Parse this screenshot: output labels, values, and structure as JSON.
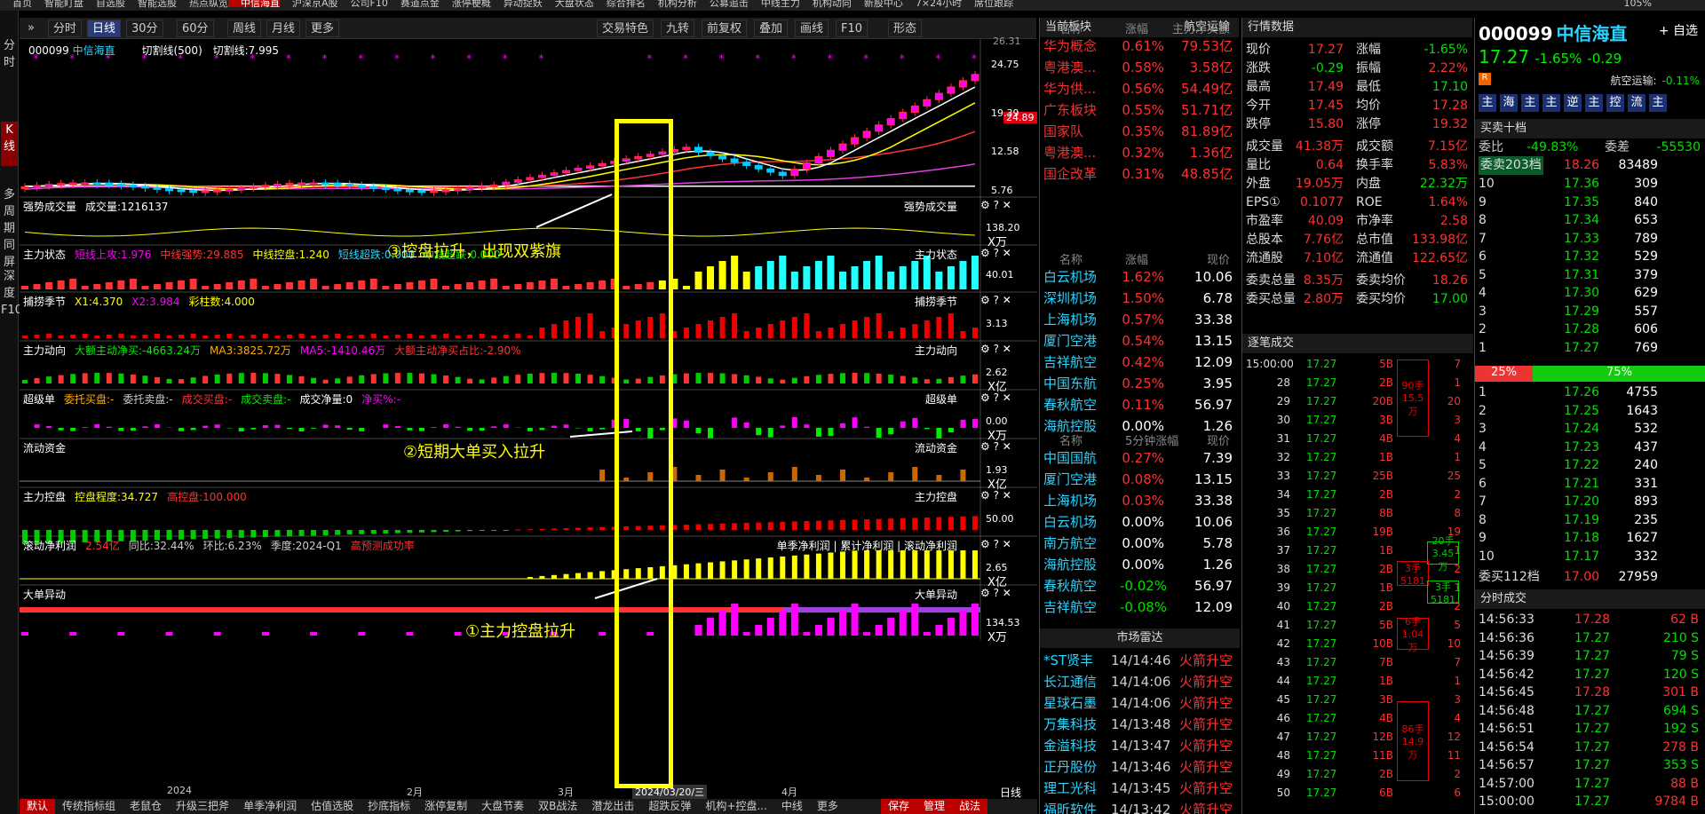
{
  "topnav": {
    "items": [
      "首页",
      "智能盯盘",
      "自选股",
      "智能选股",
      "热点纵览",
      "中信海直",
      "沪深京A股",
      "公司F10",
      "赛道点金",
      "涨停梗概",
      "异动捉妖",
      "大盘状态",
      "综合排名",
      "机构分析",
      "公募追击",
      "中线主力",
      "机构动向",
      "新股中心",
      "7×24小时",
      "席位跟踪"
    ],
    "active": "中信海直",
    "zoom": "105%"
  },
  "leftbar": {
    "items": [
      "分时",
      "K线",
      "多周期同屏",
      "深度F10"
    ]
  },
  "toolbar": {
    "periods": [
      "分时",
      "日线",
      "30分",
      "60分",
      "周线",
      "月线",
      "更多"
    ],
    "active": "日线",
    "right": [
      "交易特色",
      "九转",
      "前复权",
      "叠加",
      "画线",
      "F10",
      "形态"
    ]
  },
  "main": {
    "stock_code": "000099",
    "stock_name": "中信海直",
    "indicator": "切割线(500)",
    "cut_line": "切割线:7.995",
    "y_labels": [
      "24.75",
      "19.39",
      "12.58",
      "5.76"
    ],
    "price_flag": "24.89",
    "top_label": "26.31",
    "x_labels": [
      "2024",
      "2月",
      "3月",
      "2024/03/20/三",
      "4月"
    ],
    "x_label_right": "日线"
  },
  "panels": [
    {
      "title": "强势成交量",
      "items": [
        {
          "t": "成交量:1216137",
          "c": "#fff"
        }
      ],
      "right": "强势成交量",
      "val": "138.20",
      "unit": "X万"
    },
    {
      "title": "主力状态",
      "items": [
        {
          "t": "短线上攻:1.976",
          "c": "#f0f"
        },
        {
          "t": "中线强势:29.885",
          "c": "#f33"
        },
        {
          "t": "中线控盘:1.240",
          "c": "#ff0"
        },
        {
          "t": "短线超跌:0.000",
          "c": "#2ad4ff"
        },
        {
          "t": "中线超跌:0.000",
          "c": "#0e0"
        }
      ],
      "right": "主力状态",
      "val": "40.01",
      "unit": ""
    },
    {
      "title": "捕捞季节",
      "items": [
        {
          "t": "X1:4.370",
          "c": "#ff0"
        },
        {
          "t": "X2:3.984",
          "c": "#f0f"
        },
        {
          "t": "彩柱数:4.000",
          "c": "#ff0"
        }
      ],
      "right": "捕捞季节",
      "val": "3.13",
      "unit": ""
    },
    {
      "title": "主力动向",
      "items": [
        {
          "t": "大额主动净买:-4663.24万",
          "c": "#0e0"
        },
        {
          "t": "MA3:3825.72万",
          "c": "#fa0"
        },
        {
          "t": "MA5:-1410.46万",
          "c": "#f0f"
        },
        {
          "t": "大额主动净买占比:-2.90%",
          "c": "#f33"
        }
      ],
      "right": "主力动向",
      "val": "2.62",
      "unit": "X亿"
    },
    {
      "title": "超级单",
      "items": [
        {
          "t": "委托买盘:-",
          "c": "#fa0"
        },
        {
          "t": "委托卖盘:-",
          "c": "#ccc"
        },
        {
          "t": "成交买盘:-",
          "c": "#f33"
        },
        {
          "t": "成交卖盘:-",
          "c": "#0e0"
        },
        {
          "t": "成交净量:0",
          "c": "#fff"
        },
        {
          "t": "净买%:-",
          "c": "#f0f"
        }
      ],
      "right": "超级单",
      "val": "0.00",
      "unit": "X万"
    },
    {
      "title": "流动资金",
      "items": [],
      "right": "流动资金",
      "val": "1.93",
      "unit": "X亿"
    },
    {
      "title": "主力控盘",
      "items": [
        {
          "t": "控盘程度:34.727",
          "c": "#ff0"
        },
        {
          "t": "高控盘:100.000",
          "c": "#f33"
        }
      ],
      "right": "主力控盘",
      "val": "50.00",
      "unit": ""
    },
    {
      "title": "滚动净利润",
      "items": [
        {
          "t": "2.54亿",
          "c": "#f33"
        },
        {
          "t": "同比:32.44%",
          "c": "#ccc"
        },
        {
          "t": "环比:6.23%",
          "c": "#ccc"
        },
        {
          "t": "季度:2024-Q1",
          "c": "#ccc"
        },
        {
          "t": "高预测成功率",
          "c": "#f33"
        }
      ],
      "right": "单季净利润 | 累计净利润 | 滚动净利润",
      "val": "2.65",
      "unit": "X亿"
    },
    {
      "title": "大单异动",
      "items": [],
      "right": "大单异动",
      "val": "134.53",
      "unit": "X万"
    }
  ],
  "annotations": [
    "③控盘拉升，出现双紫旗",
    "②短期大单买入拉升",
    "①主力控盘拉升"
  ],
  "bottom_tabs": [
    "默认",
    "传统指标组",
    "老鼠仓",
    "升级三把斧",
    "单季净利润",
    "估值选股",
    "抄底指标",
    "涨停复制",
    "大盘节奏",
    "双B战法",
    "潜龙出击",
    "超跌反弹",
    "机构+控盘...",
    "中线",
    "更多",
    "保存",
    "管理",
    "战法"
  ],
  "sector": {
    "header": "当前板块",
    "header_right": "航空运输",
    "g1_cols": [
      "名称",
      "涨幅",
      "主力净买额"
    ],
    "g1": [
      [
        "华为概念",
        "0.61%",
        "79.53亿"
      ],
      [
        "粤港澳...",
        "0.58%",
        "3.58亿"
      ],
      [
        "华为供...",
        "0.56%",
        "54.49亿"
      ],
      [
        "广东板块",
        "0.55%",
        "51.71亿"
      ],
      [
        "国家队",
        "0.35%",
        "81.89亿"
      ],
      [
        "粤港澳...",
        "0.32%",
        "1.36亿"
      ],
      [
        "国企改革",
        "0.31%",
        "48.85亿"
      ]
    ],
    "g2_cols": [
      "名称",
      "涨幅",
      "现价"
    ],
    "g2": [
      [
        "白云机场",
        "1.62%",
        "10.06"
      ],
      [
        "深圳机场",
        "1.50%",
        "6.78"
      ],
      [
        "上海机场",
        "0.57%",
        "33.38"
      ],
      [
        "厦门空港",
        "0.54%",
        "13.15"
      ],
      [
        "吉祥航空",
        "0.42%",
        "12.09"
      ],
      [
        "中国东航",
        "0.25%",
        "3.95"
      ],
      [
        "春秋航空",
        "0.11%",
        "56.97"
      ],
      [
        "海航控股",
        "0.00%",
        "1.26"
      ]
    ],
    "g3_cols": [
      "名称",
      "5分钟涨幅",
      "现价"
    ],
    "g3": [
      [
        "中国国航",
        "0.27%",
        "7.39"
      ],
      [
        "厦门空港",
        "0.08%",
        "13.15"
      ],
      [
        "上海机场",
        "0.03%",
        "33.38"
      ],
      [
        "白云机场",
        "0.00%",
        "10.06"
      ],
      [
        "南方航空",
        "0.00%",
        "5.78"
      ],
      [
        "海航控股",
        "0.00%",
        "1.26"
      ],
      [
        "春秋航空",
        "-0.02%",
        "56.97"
      ],
      [
        "吉祥航空",
        "-0.08%",
        "12.09"
      ]
    ],
    "radar_title": "市场雷达",
    "radar": [
      [
        "*ST贤丰",
        "14/14:46",
        "火箭升空"
      ],
      [
        "长江通信",
        "14/14:06",
        "火箭升空"
      ],
      [
        "星球石墨",
        "14/14:06",
        "火箭升空"
      ],
      [
        "万集科技",
        "14/13:48",
        "火箭升空"
      ],
      [
        "金溢科技",
        "14/13:47",
        "火箭升空"
      ],
      [
        "正丹股份",
        "14/13:46",
        "火箭升空"
      ],
      [
        "理工光科",
        "14/13:45",
        "火箭升空"
      ],
      [
        "福昕软件",
        "14/13:42",
        "火箭升空"
      ]
    ]
  },
  "quote": {
    "title": "行情数据",
    "rows": [
      [
        "现价",
        "17.27",
        "涨幅",
        "-1.65%"
      ],
      [
        "涨跌",
        "-0.29",
        "振幅",
        "2.22%"
      ],
      [
        "最高",
        "17.49",
        "最低",
        "17.10"
      ],
      [
        "今开",
        "17.45",
        "均价",
        "17.28"
      ],
      [
        "跌停",
        "15.80",
        "涨停",
        "19.32"
      ],
      [
        "成交量",
        "41.38万",
        "成交额",
        "7.15亿"
      ],
      [
        "量比",
        "0.64",
        "换手率",
        "5.83%"
      ],
      [
        "外盘",
        "19.05万",
        "内盘",
        "22.32万"
      ],
      [
        "EPS①",
        "0.1077",
        "ROE",
        "1.64%"
      ],
      [
        "市盈率",
        "40.09",
        "市净率",
        "2.58"
      ],
      [
        "总股本",
        "7.76亿",
        "总市值",
        "133.98亿"
      ],
      [
        "流通股",
        "7.10亿",
        "流通值",
        "122.65亿"
      ],
      [
        "委卖总量",
        "8.35万",
        "委卖均价",
        "18.26"
      ],
      [
        "委买总量",
        "2.80万",
        "委买均价",
        "17.00"
      ]
    ],
    "tick_title": "逐笔成交",
    "ticks": [
      [
        "15:00:00",
        "17.27",
        "5B",
        "7"
      ],
      [
        "28",
        "17.27",
        "2B",
        "1"
      ],
      [
        "29",
        "17.27",
        "20B",
        "20"
      ],
      [
        "30",
        "17.27",
        "3B",
        "3"
      ],
      [
        "31",
        "17.27",
        "4B",
        "4"
      ],
      [
        "32",
        "17.27",
        "1B",
        "1"
      ],
      [
        "33",
        "17.27",
        "25B",
        "25"
      ],
      [
        "34",
        "17.27",
        "2B",
        "2"
      ],
      [
        "35",
        "17.27",
        "8B",
        "8"
      ],
      [
        "36",
        "17.27",
        "19B",
        "19"
      ],
      [
        "37",
        "17.27",
        "1B",
        "1"
      ],
      [
        "38",
        "17.27",
        "2B",
        "2"
      ],
      [
        "39",
        "17.27",
        "1B",
        "1"
      ],
      [
        "40",
        "17.27",
        "2B",
        "2"
      ],
      [
        "41",
        "17.27",
        "5B",
        "5"
      ],
      [
        "42",
        "17.27",
        "10B",
        "10"
      ],
      [
        "43",
        "17.27",
        "7B",
        "7"
      ],
      [
        "44",
        "17.27",
        "1B",
        "1"
      ],
      [
        "45",
        "17.27",
        "3B",
        "3"
      ],
      [
        "46",
        "17.27",
        "4B",
        "4"
      ],
      [
        "47",
        "17.27",
        "12B",
        "12"
      ],
      [
        "48",
        "17.27",
        "11B",
        "11"
      ],
      [
        "49",
        "17.27",
        "2B",
        "2"
      ],
      [
        "50",
        "17.27",
        "6B",
        "6"
      ]
    ],
    "tick_boxes": [
      "90手\n15.5万",
      "20手\n3.45万",
      "3手\n5181",
      "3手\n5181",
      "6手\n1.04万",
      "86手\n14.9万"
    ]
  },
  "orderbook": {
    "code": "000099",
    "name": "中信海直",
    "self_select": "+ 自选",
    "price": "17.27",
    "chg": "-1.65%",
    "chg_abs": "-0.29",
    "industry": "航空运输:",
    "industry_chg": "-0.11%",
    "tags": [
      "主",
      "海",
      "主",
      "主",
      "逆",
      "主",
      "控",
      "流",
      "主"
    ],
    "title": "买卖十档",
    "wb": "委比",
    "wb_val": "-49.83%",
    "wc": "委差",
    "wc_val": "-55530",
    "sell_head": [
      "委卖203档",
      "18.26",
      "83489"
    ],
    "sells": [
      [
        "10",
        "17.36",
        "309"
      ],
      [
        "9",
        "17.35",
        "840"
      ],
      [
        "8",
        "17.34",
        "653"
      ],
      [
        "7",
        "17.33",
        "789"
      ],
      [
        "6",
        "17.32",
        "529"
      ],
      [
        "5",
        "17.31",
        "379"
      ],
      [
        "4",
        "17.30",
        "629"
      ],
      [
        "3",
        "17.29",
        "557"
      ],
      [
        "2",
        "17.28",
        "606"
      ],
      [
        "1",
        "17.27",
        "769"
      ]
    ],
    "ratio": [
      "25%",
      "75%"
    ],
    "buys": [
      [
        "1",
        "17.26",
        "4755"
      ],
      [
        "2",
        "17.25",
        "1643"
      ],
      [
        "3",
        "17.24",
        "532"
      ],
      [
        "4",
        "17.23",
        "437"
      ],
      [
        "5",
        "17.22",
        "240"
      ],
      [
        "6",
        "17.21",
        "331"
      ],
      [
        "7",
        "17.20",
        "893"
      ],
      [
        "8",
        "17.19",
        "235"
      ],
      [
        "9",
        "17.18",
        "1627"
      ],
      [
        "10",
        "17.17",
        "332"
      ]
    ],
    "buy_head": [
      "委买112档",
      "17.00",
      "27959"
    ],
    "fs_title": "分时成交",
    "fs": [
      [
        "14:56:33",
        "17.28",
        "62 B"
      ],
      [
        "14:56:36",
        "17.27",
        "210 S"
      ],
      [
        "14:56:39",
        "17.27",
        "79 S"
      ],
      [
        "14:56:42",
        "17.27",
        "120 S"
      ],
      [
        "14:56:45",
        "17.28",
        "301 B"
      ],
      [
        "14:56:48",
        "17.27",
        "694 S"
      ],
      [
        "14:56:51",
        "17.27",
        "192 S"
      ],
      [
        "14:56:54",
        "17.27",
        "278 B"
      ],
      [
        "14:56:57",
        "17.27",
        "353 S"
      ],
      [
        "14:57:00",
        "17.27",
        "88 B"
      ],
      [
        "15:00:00",
        "17.27",
        "9784 B"
      ]
    ]
  }
}
